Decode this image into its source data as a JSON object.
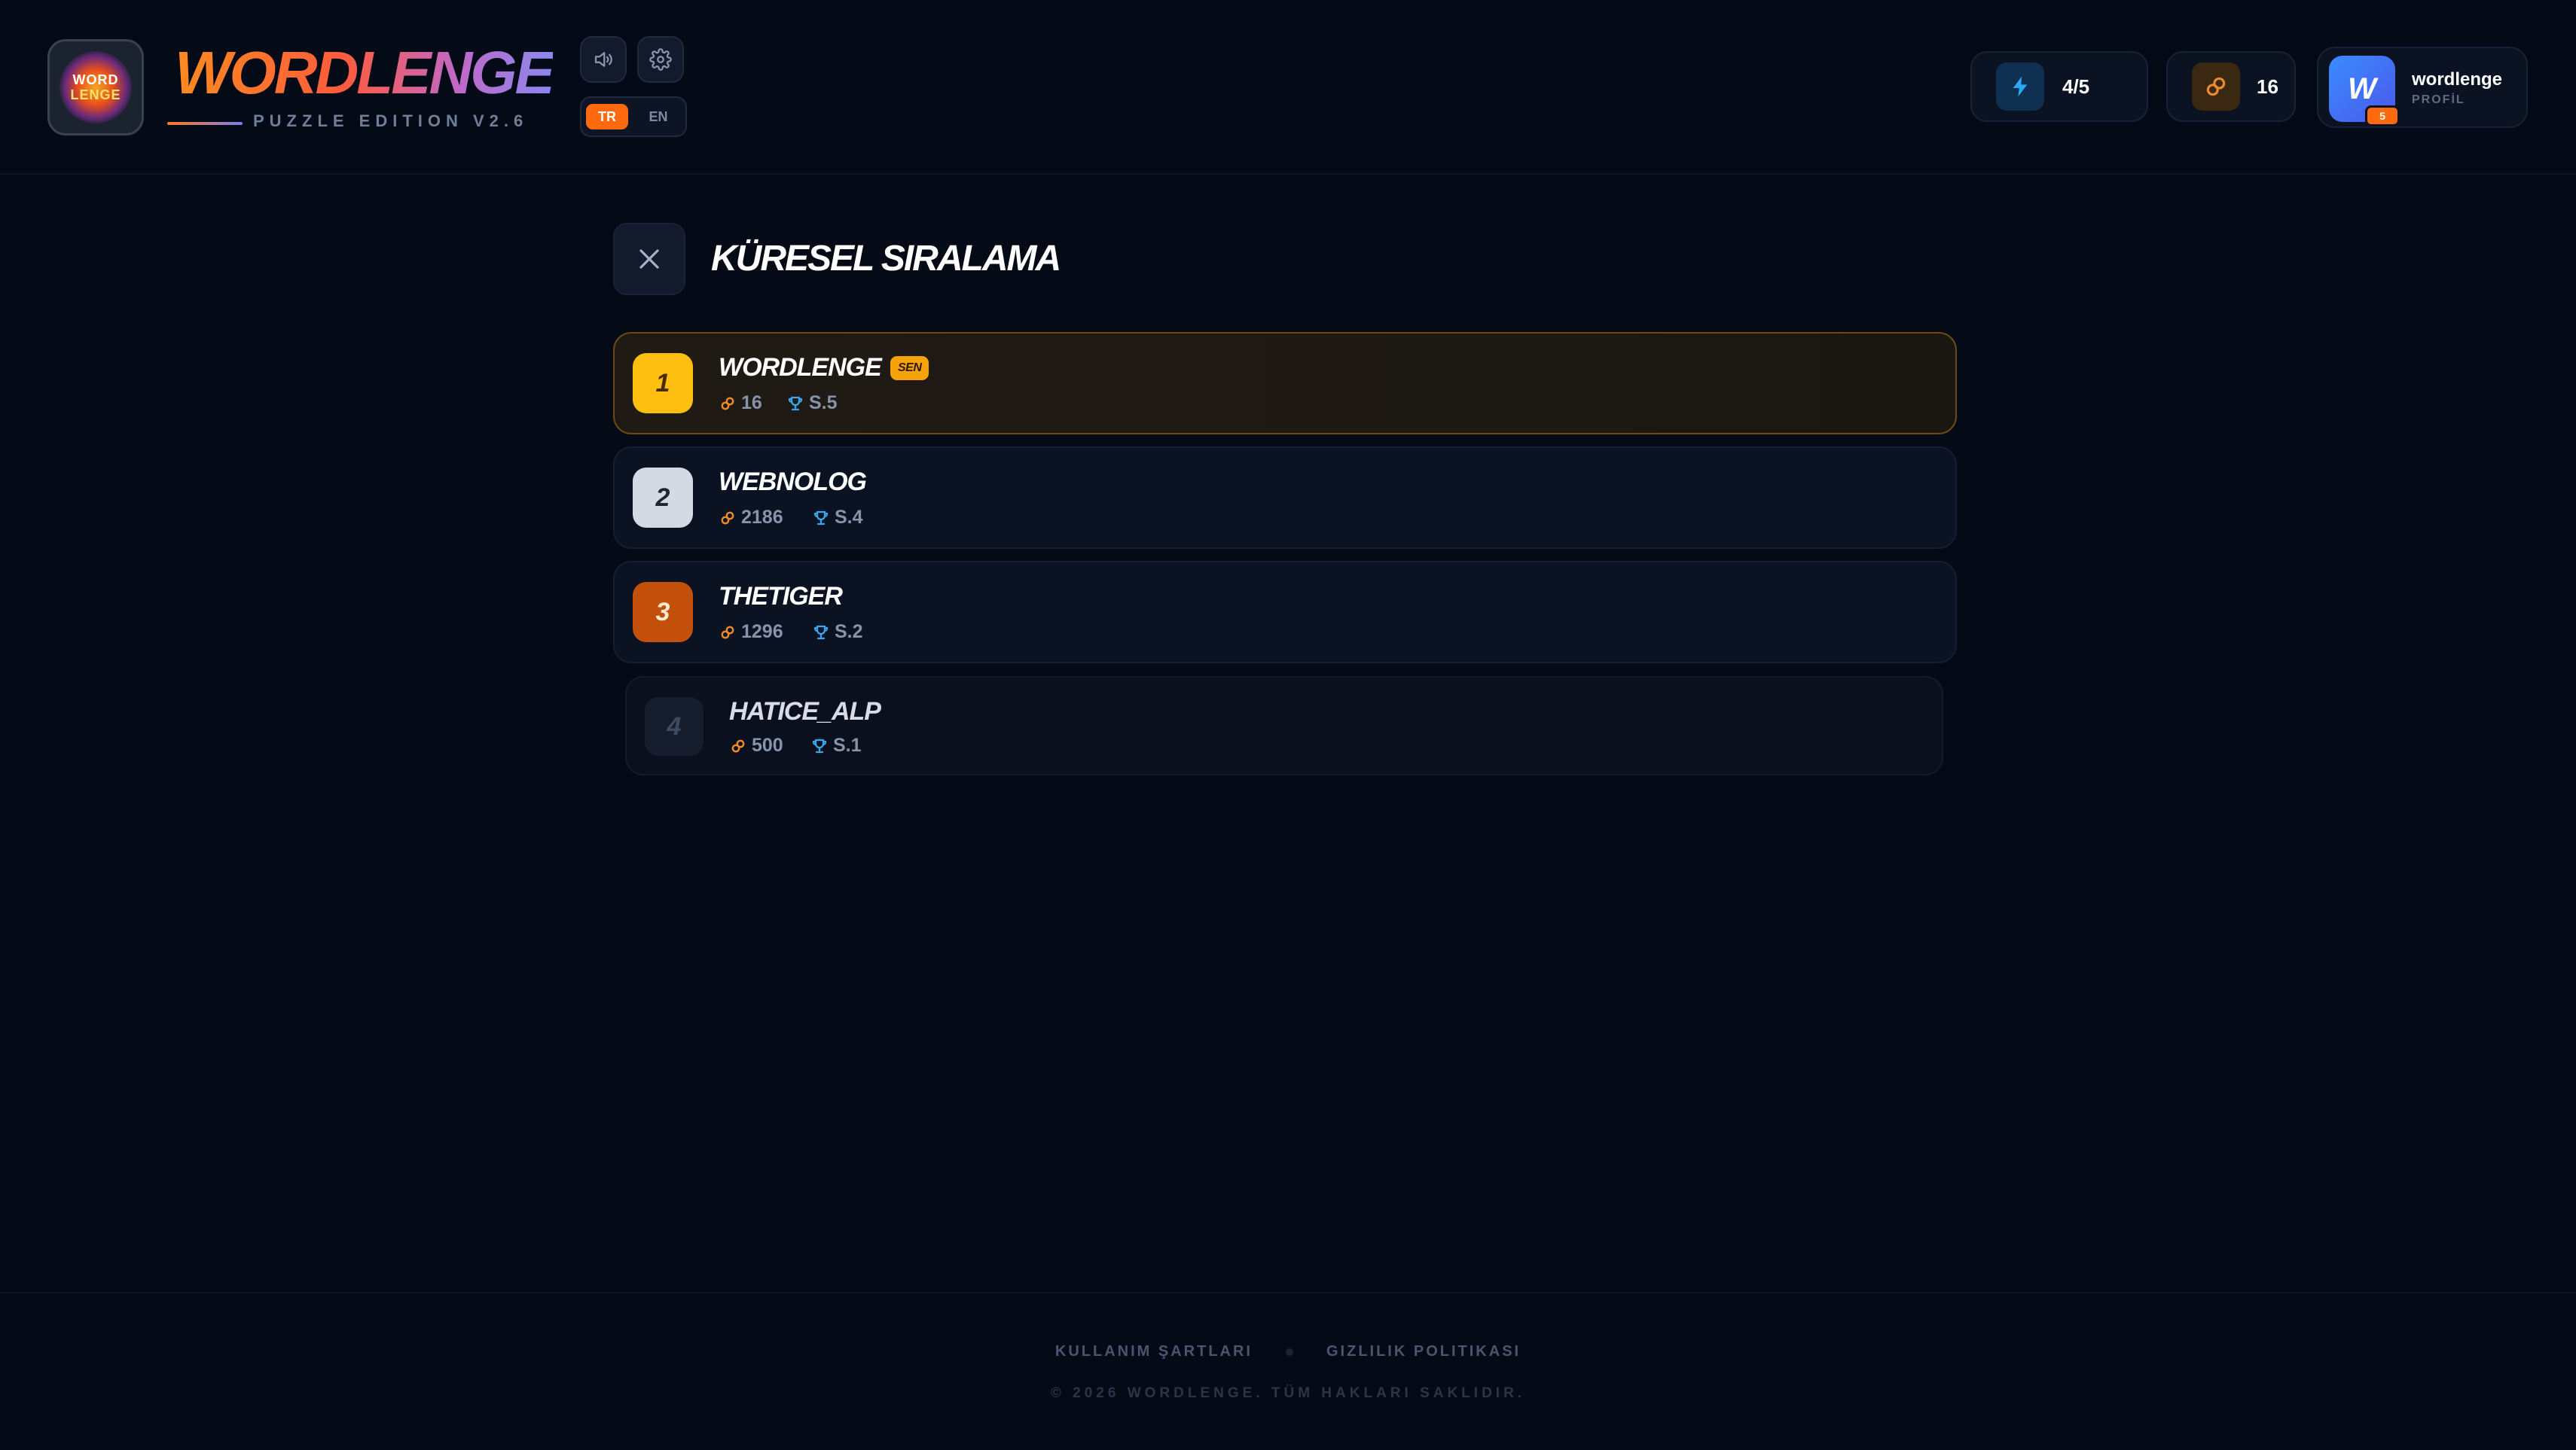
{
  "header": {
    "logo_lines": [
      "WORD",
      "LENGE"
    ],
    "brand_title": "WORDLENGE",
    "brand_subtitle": "PUZZLE EDITION V2.6",
    "sound_icon": "speaker-icon",
    "settings_icon": "gear-icon",
    "languages": [
      {
        "code": "TR",
        "active": true
      },
      {
        "code": "EN",
        "active": false
      }
    ],
    "energy": {
      "icon": "lightning-icon",
      "value": "4/5"
    },
    "coins": {
      "icon": "coin-link-icon",
      "value": "16"
    },
    "profile": {
      "avatar_letter": "W",
      "level": "5",
      "name": "wordlenge",
      "label": "PROFİL"
    }
  },
  "leaderboard": {
    "title": "KÜRESEL SIRALAMA",
    "close_icon": "close-icon",
    "current_user_badge": "SEN",
    "rows": [
      {
        "rank": "1",
        "name": "WORDLENGE",
        "score": "16",
        "level": "S.5",
        "is_me": true
      },
      {
        "rank": "2",
        "name": "WEBNOLOG",
        "score": "2186",
        "level": "S.4",
        "is_me": false
      },
      {
        "rank": "3",
        "name": "THETIGER",
        "score": "1296",
        "level": "S.2",
        "is_me": false
      },
      {
        "rank": "4",
        "name": "HATICE_ALP",
        "score": "500",
        "level": "S.1",
        "is_me": false
      }
    ]
  },
  "footer": {
    "terms_link": "KULLANIM ŞARTLARI",
    "privacy_link": "GIZLILIK POLITIKASI",
    "copyright": "© 2026 WORDLENGE. TÜM HAKLARI SAKLIDIR."
  },
  "colors": {
    "background": "#050a17",
    "accent_orange": "#ff6a10",
    "gold": "#ffc107",
    "silver": "#d4dae4",
    "bronze": "#c2500a",
    "link_icon": "#f08a2a",
    "trophy_icon": "#3aa8f0"
  }
}
